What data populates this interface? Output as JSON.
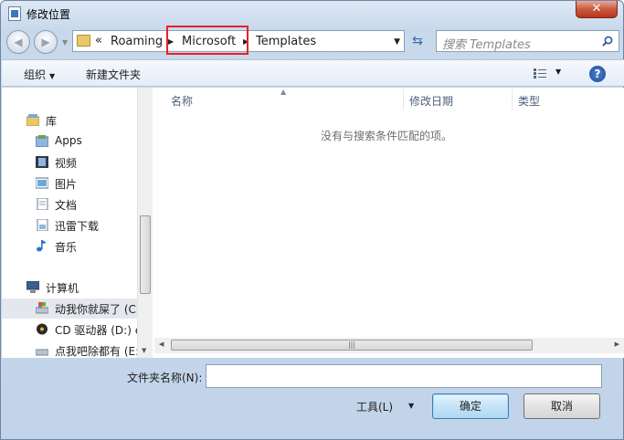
{
  "window": {
    "title": "修改位置",
    "close_glyph": "✕"
  },
  "address": {
    "overflow": "«",
    "crumbs": [
      "Roaming",
      "Microsoft",
      "Templates"
    ]
  },
  "search": {
    "placeholder": "搜索 Templates"
  },
  "toolbar": {
    "organize": "组织",
    "new_folder": "新建文件夹",
    "help": "?"
  },
  "nav": {
    "items": [
      {
        "label": "库",
        "icon": "library-icon"
      },
      {
        "label": "Apps",
        "icon": "apps-icon"
      },
      {
        "label": "视频",
        "icon": "video-icon"
      },
      {
        "label": "图片",
        "icon": "pictures-icon"
      },
      {
        "label": "文档",
        "icon": "documents-icon"
      },
      {
        "label": "迅雷下载",
        "icon": "download-icon"
      },
      {
        "label": "音乐",
        "icon": "music-icon"
      },
      {
        "label": "计算机",
        "icon": "computer-icon"
      },
      {
        "label": "动我你就屎了 (C",
        "icon": "drive-c-icon"
      },
      {
        "label": "CD 驱动器 (D:) e",
        "icon": "cd-drive-icon"
      },
      {
        "label": "点我吧除都有 (E:",
        "icon": "drive-e-icon"
      }
    ]
  },
  "columns": [
    "名称",
    "修改日期",
    "类型"
  ],
  "empty_message": "没有与搜索条件匹配的项。",
  "bottom": {
    "folder_name_label": "文件夹名称(N):",
    "folder_name_value": "",
    "tools": "工具(L)",
    "ok": "确定",
    "cancel": "取消"
  },
  "colors": {
    "highlight": "#e8202a",
    "accent": "#3c7fb1"
  }
}
